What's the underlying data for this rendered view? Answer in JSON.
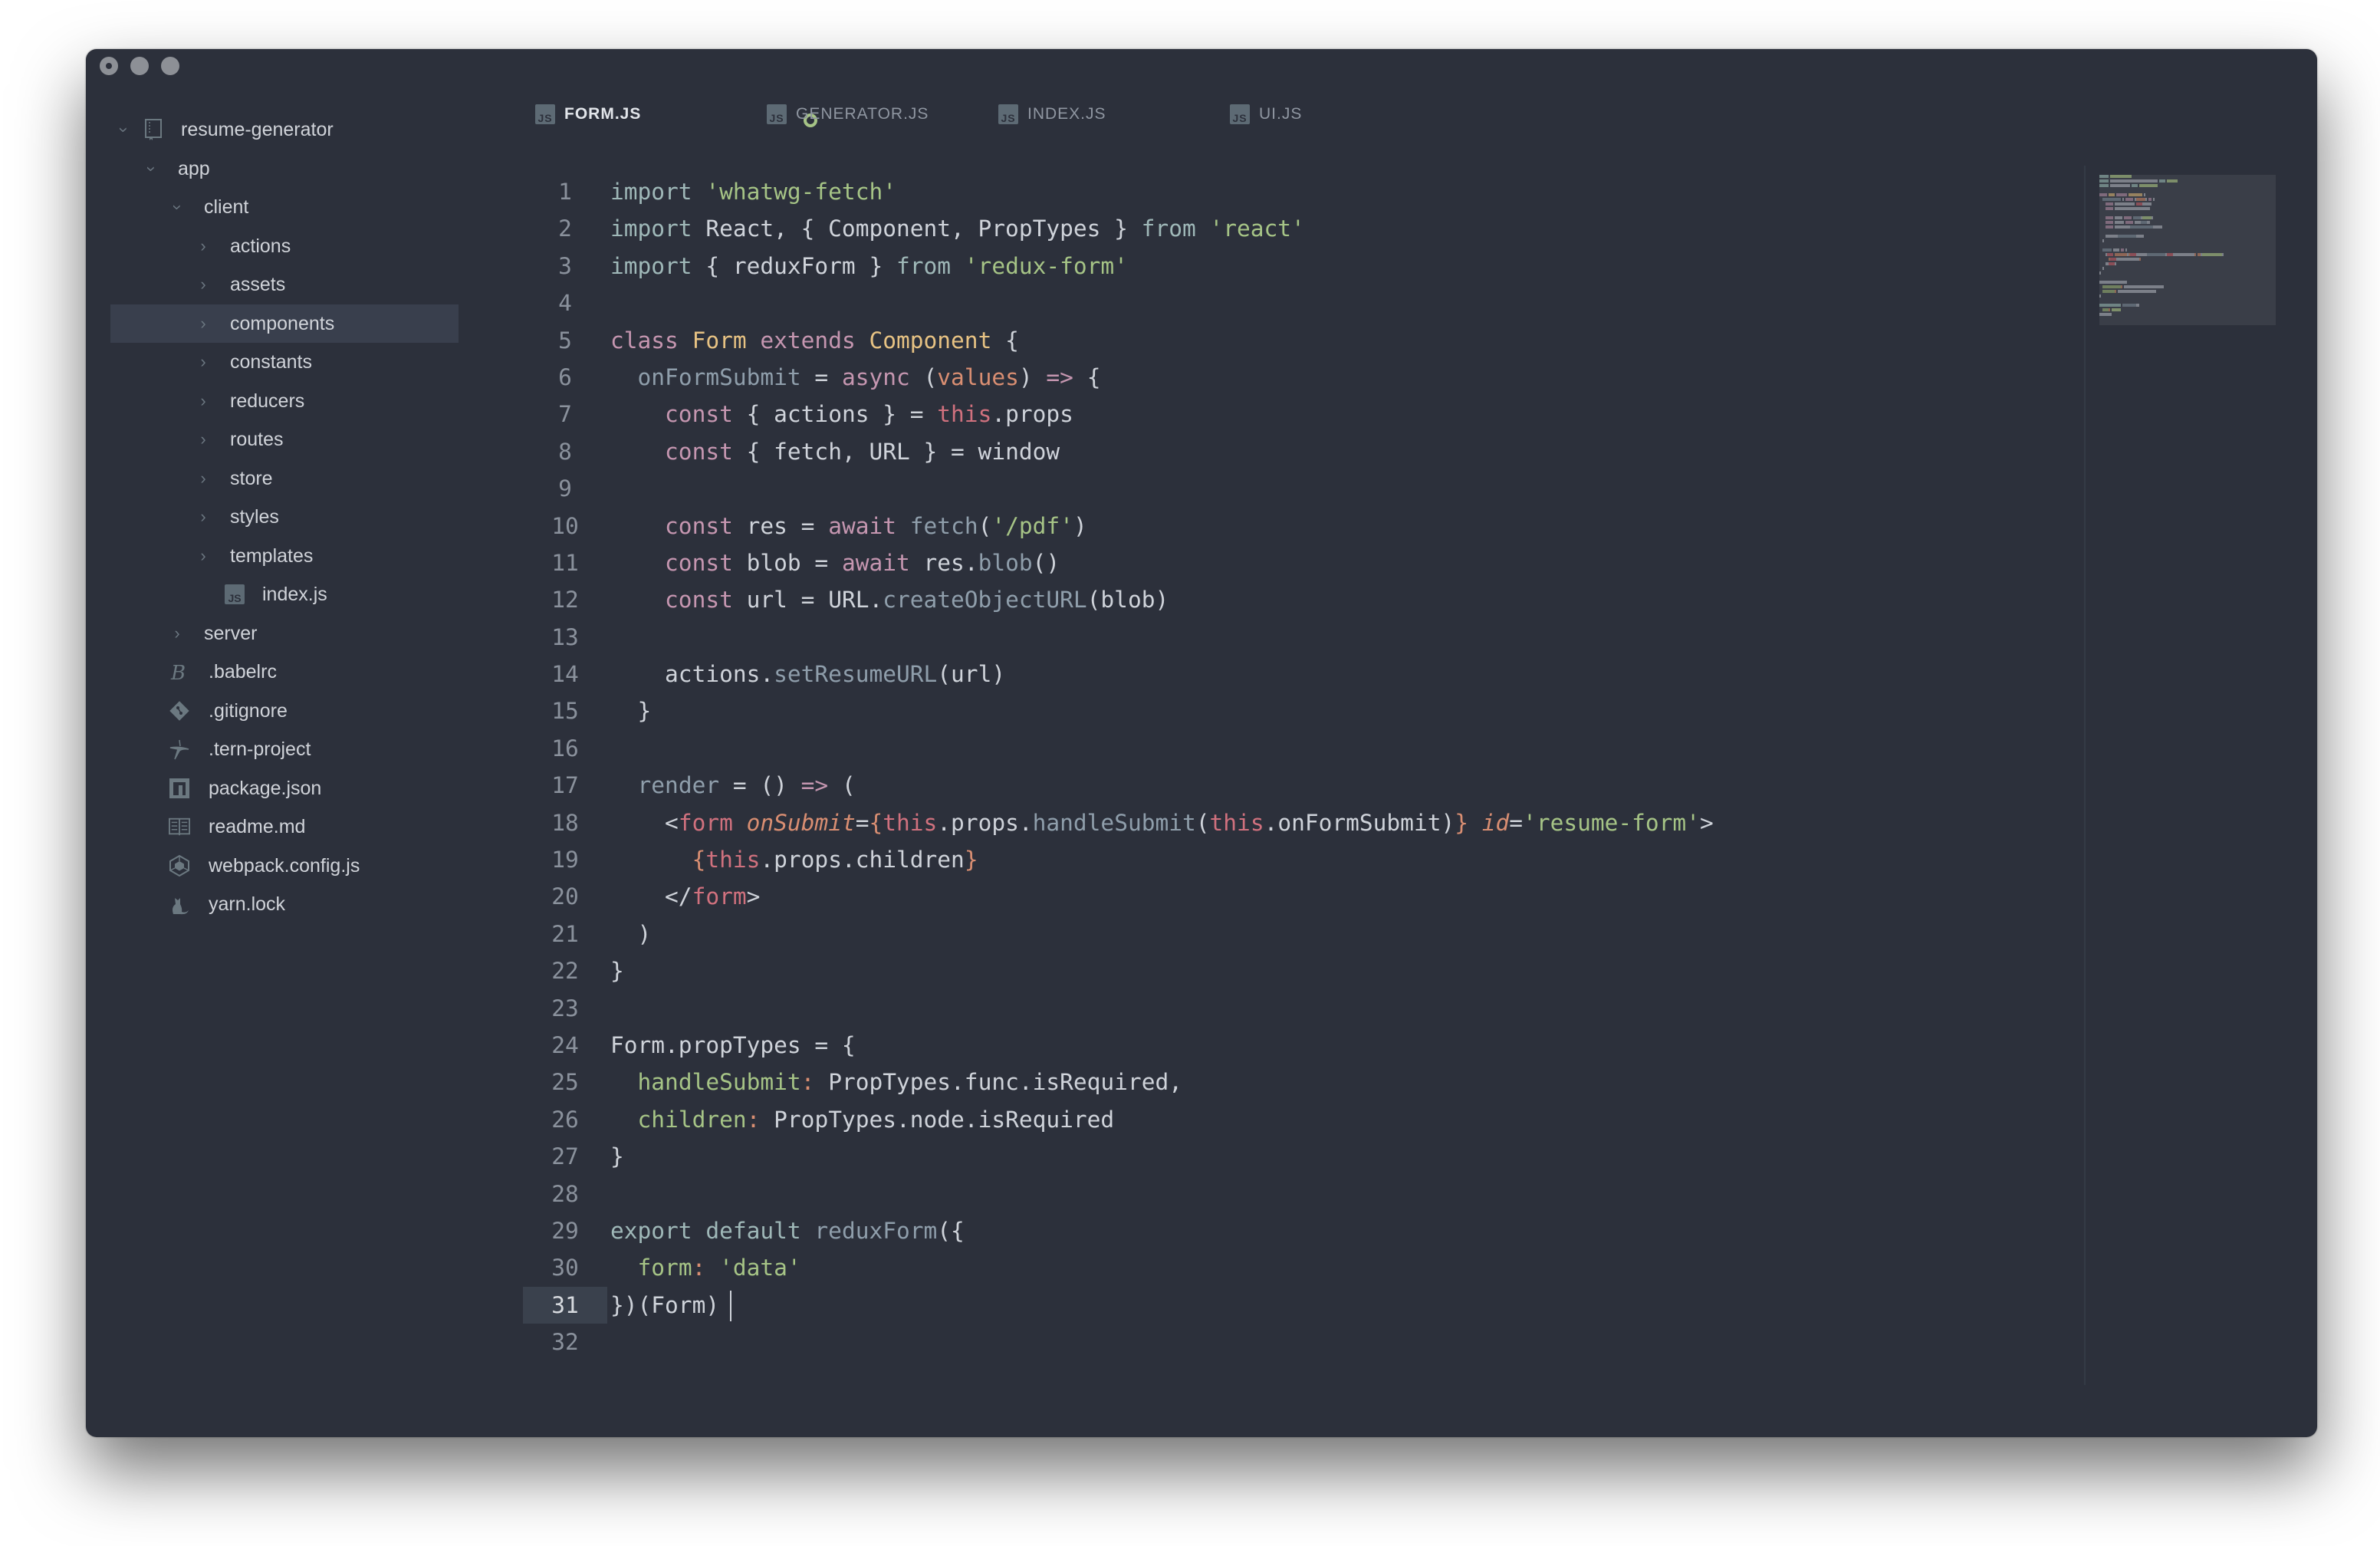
{
  "window": {
    "controls": [
      "close",
      "minimize",
      "maximize"
    ]
  },
  "sidebar": {
    "project": {
      "name": "resume-generator",
      "icon": "repo-book-icon",
      "expanded": true
    },
    "items": [
      {
        "label": "app",
        "type": "folder",
        "expanded": true,
        "depth": 1
      },
      {
        "label": "client",
        "type": "folder",
        "expanded": true,
        "depth": 2
      },
      {
        "label": "actions",
        "type": "folder",
        "expanded": false,
        "depth": 3
      },
      {
        "label": "assets",
        "type": "folder",
        "expanded": false,
        "depth": 3
      },
      {
        "label": "components",
        "type": "folder",
        "expanded": false,
        "depth": 3,
        "selected": true
      },
      {
        "label": "constants",
        "type": "folder",
        "expanded": false,
        "depth": 3
      },
      {
        "label": "reducers",
        "type": "folder",
        "expanded": false,
        "depth": 3
      },
      {
        "label": "routes",
        "type": "folder",
        "expanded": false,
        "depth": 3
      },
      {
        "label": "store",
        "type": "folder",
        "expanded": false,
        "depth": 3
      },
      {
        "label": "styles",
        "type": "folder",
        "expanded": false,
        "depth": 3
      },
      {
        "label": "templates",
        "type": "folder",
        "expanded": false,
        "depth": 3
      },
      {
        "label": "index.js",
        "type": "file",
        "icon": "js-file-icon",
        "depth": 4
      },
      {
        "label": "server",
        "type": "folder",
        "expanded": false,
        "depth": 2
      },
      {
        "label": ".babelrc",
        "type": "file",
        "icon": "babel-icon",
        "depth": 1
      },
      {
        "label": ".gitignore",
        "type": "file",
        "icon": "git-icon",
        "depth": 1
      },
      {
        "label": ".tern-project",
        "type": "file",
        "icon": "tern-icon",
        "depth": 1
      },
      {
        "label": "package.json",
        "type": "file",
        "icon": "npm-icon",
        "depth": 1
      },
      {
        "label": "readme.md",
        "type": "file",
        "icon": "readme-book-icon",
        "depth": 1
      },
      {
        "label": "webpack.config.js",
        "type": "file",
        "icon": "webpack-icon",
        "depth": 1
      },
      {
        "label": "yarn.lock",
        "type": "file",
        "icon": "yarn-icon",
        "depth": 1
      }
    ]
  },
  "tabs": [
    {
      "label": "FORM.JS",
      "icon": "JS",
      "active": true,
      "modified": true
    },
    {
      "label": "GENERATOR.JS",
      "icon": "JS",
      "active": false
    },
    {
      "label": "INDEX.JS",
      "icon": "JS",
      "active": false
    },
    {
      "label": "UI.JS",
      "icon": "JS",
      "active": false
    }
  ],
  "editor": {
    "current_line": 31,
    "lines": [
      [
        [
          "kw",
          "import "
        ],
        [
          "str",
          "'whatwg-fetch'"
        ]
      ],
      [
        [
          "kw",
          "import "
        ],
        [
          "plain",
          "React, { Component, PropTypes } "
        ],
        [
          "kw",
          "from "
        ],
        [
          "str",
          "'react'"
        ]
      ],
      [
        [
          "kw",
          "import "
        ],
        [
          "plain",
          "{ reduxForm } "
        ],
        [
          "kw",
          "from "
        ],
        [
          "str",
          "'redux-form'"
        ]
      ],
      [],
      [
        [
          "st",
          "class "
        ],
        [
          "cls",
          "Form "
        ],
        [
          "st",
          "extends "
        ],
        [
          "cls",
          "Component "
        ],
        [
          "plain",
          "{"
        ]
      ],
      [
        [
          "plain",
          "  "
        ],
        [
          "fn",
          "onFormSubmit "
        ],
        [
          "plain",
          "= "
        ],
        [
          "st",
          "async "
        ],
        [
          "plain",
          "("
        ],
        [
          "param",
          "values"
        ],
        [
          "plain",
          ") "
        ],
        [
          "st",
          "=> "
        ],
        [
          "plain",
          "{"
        ]
      ],
      [
        [
          "plain",
          "    "
        ],
        [
          "st",
          "const "
        ],
        [
          "plain",
          "{ actions } = "
        ],
        [
          "this",
          "this"
        ],
        [
          "plain",
          ".props"
        ]
      ],
      [
        [
          "plain",
          "    "
        ],
        [
          "st",
          "const "
        ],
        [
          "plain",
          "{ fetch, URL } = window"
        ]
      ],
      [],
      [
        [
          "plain",
          "    "
        ],
        [
          "st",
          "const "
        ],
        [
          "plain",
          "res = "
        ],
        [
          "st",
          "await "
        ],
        [
          "fn",
          "fetch"
        ],
        [
          "plain",
          "("
        ],
        [
          "str",
          "'/pdf'"
        ],
        [
          "plain",
          ")"
        ]
      ],
      [
        [
          "plain",
          "    "
        ],
        [
          "st",
          "const "
        ],
        [
          "plain",
          "blob = "
        ],
        [
          "st",
          "await "
        ],
        [
          "plain",
          "res."
        ],
        [
          "fn",
          "blob"
        ],
        [
          "plain",
          "()"
        ]
      ],
      [
        [
          "plain",
          "    "
        ],
        [
          "st",
          "const "
        ],
        [
          "plain",
          "url = URL."
        ],
        [
          "fn",
          "createObjectURL"
        ],
        [
          "plain",
          "(blob)"
        ]
      ],
      [],
      [
        [
          "plain",
          "    actions."
        ],
        [
          "fn",
          "setResumeURL"
        ],
        [
          "plain",
          "(url)"
        ]
      ],
      [
        [
          "plain",
          "  }"
        ]
      ],
      [],
      [
        [
          "plain",
          "  "
        ],
        [
          "fn",
          "render "
        ],
        [
          "plain",
          "= () "
        ],
        [
          "st",
          "=> "
        ],
        [
          "plain",
          "("
        ]
      ],
      [
        [
          "plain",
          "    <"
        ],
        [
          "tag",
          "form "
        ],
        [
          "attr",
          "onSubmit"
        ],
        [
          "plain",
          "="
        ],
        [
          "brace",
          "{"
        ],
        [
          "this",
          "this"
        ],
        [
          "plain",
          ".props."
        ],
        [
          "fn",
          "handleSubmit"
        ],
        [
          "plain",
          "("
        ],
        [
          "this",
          "this"
        ],
        [
          "plain",
          ".onFormSubmit)"
        ],
        [
          "brace",
          "}"
        ],
        [
          "plain",
          " "
        ],
        [
          "attr",
          "id"
        ],
        [
          "plain",
          "="
        ],
        [
          "str",
          "'resume-form'"
        ],
        [
          "plain",
          ">"
        ]
      ],
      [
        [
          "plain",
          "      "
        ],
        [
          "brace",
          "{"
        ],
        [
          "this",
          "this"
        ],
        [
          "plain",
          ".props.children"
        ],
        [
          "brace",
          "}"
        ]
      ],
      [
        [
          "plain",
          "    </"
        ],
        [
          "tag",
          "form"
        ],
        [
          "plain",
          ">"
        ]
      ],
      [
        [
          "plain",
          "  )"
        ]
      ],
      [
        [
          "plain",
          "}"
        ]
      ],
      [],
      [
        [
          "plain",
          "Form.propTypes = {"
        ]
      ],
      [
        [
          "plain",
          "  "
        ],
        [
          "prop",
          "handleSubmit"
        ],
        [
          "colon",
          ": "
        ],
        [
          "plain",
          "PropTypes.func.isRequired,"
        ]
      ],
      [
        [
          "plain",
          "  "
        ],
        [
          "prop",
          "children"
        ],
        [
          "colon",
          ": "
        ],
        [
          "plain",
          "PropTypes.node.isRequired"
        ]
      ],
      [
        [
          "plain",
          "}"
        ]
      ],
      [],
      [
        [
          "kw",
          "export default "
        ],
        [
          "fn",
          "reduxForm"
        ],
        [
          "plain",
          "({"
        ]
      ],
      [
        [
          "plain",
          "  "
        ],
        [
          "prop",
          "form"
        ],
        [
          "colon",
          ": "
        ],
        [
          "str",
          "'data'"
        ]
      ],
      [
        [
          "plain",
          "})(Form)"
        ]
      ],
      []
    ]
  },
  "colors": {
    "background": "#2c303b",
    "selection": "#393f4d",
    "string": "#a6c486",
    "storage": "#c596b0",
    "class": "#e7c283",
    "this": "#d0717e",
    "modified_indicator": "#a6c486"
  }
}
